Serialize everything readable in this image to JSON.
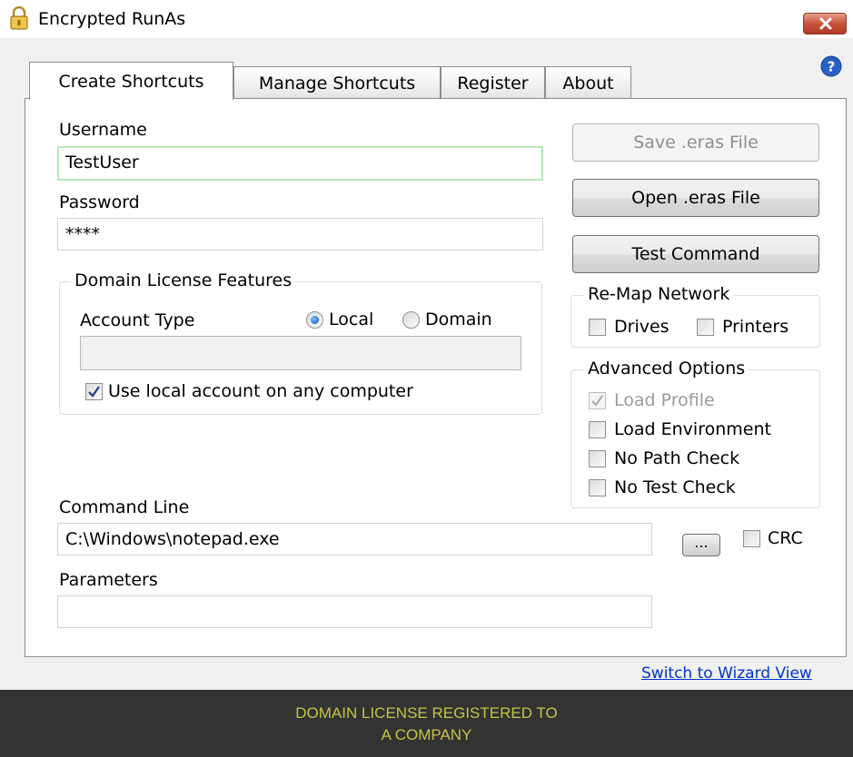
{
  "window": {
    "title": "Encrypted RunAs"
  },
  "tabs": [
    {
      "label": "Create Shortcuts",
      "active": true
    },
    {
      "label": "Manage Shortcuts",
      "active": false
    },
    {
      "label": "Register",
      "active": false
    },
    {
      "label": "About",
      "active": false
    }
  ],
  "form": {
    "username_label": "Username",
    "username_value": "TestUser",
    "password_label": "Password",
    "password_value": "****",
    "command_line_label": "Command Line",
    "command_line_value": "C:\\Windows\\notepad.exe",
    "browse_label": "...",
    "crc_label": "CRC",
    "crc_checked": false,
    "parameters_label": "Parameters",
    "parameters_value": ""
  },
  "domain_license": {
    "group_title": "Domain License Features",
    "account_type_label": "Account Type",
    "local_label": "Local",
    "domain_label": "Domain",
    "selected": "Local",
    "domain_field_value": "",
    "use_local_label": "Use local account on any computer",
    "use_local_checked": true
  },
  "buttons": {
    "save_label": "Save .eras File",
    "open_label": "Open .eras File",
    "test_label": "Test Command"
  },
  "remap_network": {
    "group_title": "Re-Map Network",
    "drives_label": "Drives",
    "drives_checked": false,
    "printers_label": "Printers",
    "printers_checked": false
  },
  "advanced_options": {
    "group_title": "Advanced Options",
    "load_profile_label": "Load Profile",
    "load_profile_checked": true,
    "load_profile_disabled": true,
    "load_environment_label": "Load Environment",
    "load_environment_checked": false,
    "no_path_check_label": "No Path Check",
    "no_path_check_checked": false,
    "no_test_check_label": "No Test Check",
    "no_test_check_checked": false
  },
  "links": {
    "wizard_view": "Switch to Wizard View"
  },
  "footer": {
    "line1": "DOMAIN LICENSE REGISTERED TO",
    "line2": "A COMPANY"
  },
  "colors": {
    "footer_bg": "#333333",
    "footer_text": "#c4c446",
    "link": "#0033cc",
    "close_button": "#c8523c"
  },
  "icons": {
    "app": "lock-icon",
    "close": "close-icon",
    "help": "help-icon"
  }
}
